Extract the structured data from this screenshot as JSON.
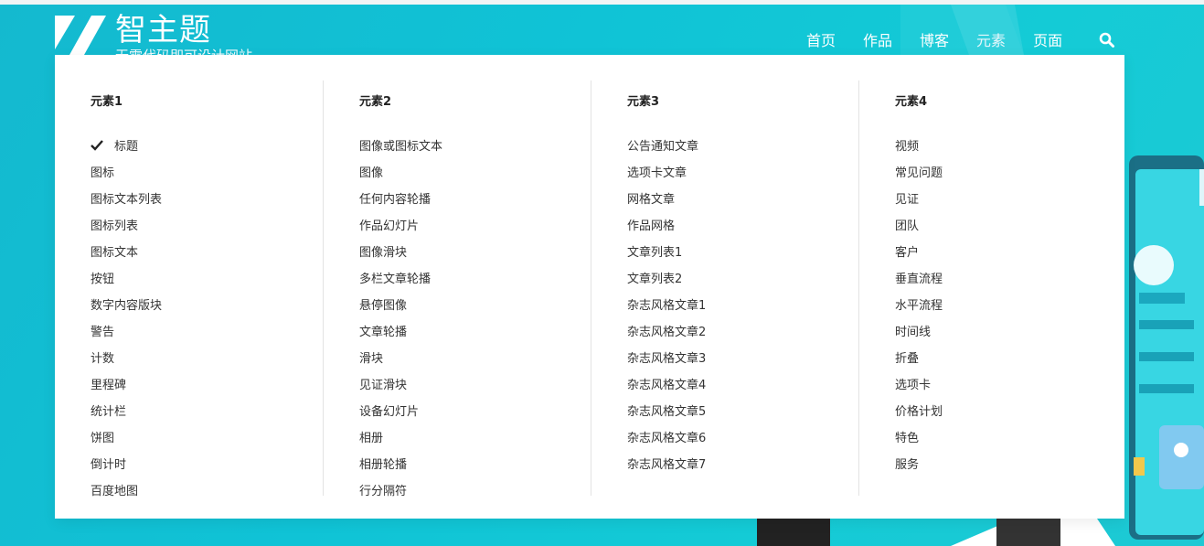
{
  "site": {
    "title": "智主题",
    "subtitle": "无需代码即可设计网站"
  },
  "nav": {
    "items": [
      {
        "label": "首页"
      },
      {
        "label": "作品"
      },
      {
        "label": "博客"
      },
      {
        "label": "元素"
      },
      {
        "label": "页面"
      }
    ],
    "search_icon": "search-icon"
  },
  "mega_menu": {
    "columns": [
      {
        "heading": "元素1",
        "items": [
          "标题",
          "图标",
          "图标文本列表",
          "图标列表",
          "图标文本",
          "按钮",
          "数字内容版块",
          "警告",
          "计数",
          "里程碑",
          "统计栏",
          "饼图",
          "倒计时",
          "百度地图"
        ],
        "checked_index": 0
      },
      {
        "heading": "元素2",
        "items": [
          "图像或图标文本",
          "图像",
          "任何内容轮播",
          "作品幻灯片",
          "图像滑块",
          "多栏文章轮播",
          "悬停图像",
          "文章轮播",
          "滑块",
          "见证滑块",
          "设备幻灯片",
          "相册",
          "相册轮播",
          "行分隔符"
        ]
      },
      {
        "heading": "元素3",
        "items": [
          "公告通知文章",
          "选项卡文章",
          "网格文章",
          "作品网格",
          "文章列表1",
          "文章列表2",
          "杂志风格文章1",
          "杂志风格文章2",
          "杂志风格文章3",
          "杂志风格文章4",
          "杂志风格文章5",
          "杂志风格文章6",
          "杂志风格文章7"
        ]
      },
      {
        "heading": "元素4",
        "items": [
          "视频",
          "常见问题",
          "见证",
          "团队",
          "客户",
          "垂直流程",
          "水平流程",
          "时间线",
          "折叠",
          "选项卡",
          "价格计划",
          "特色",
          "服务"
        ]
      }
    ]
  },
  "colors": {
    "background": "#14c1d4",
    "panel": "#ffffff",
    "text": "#333333"
  }
}
